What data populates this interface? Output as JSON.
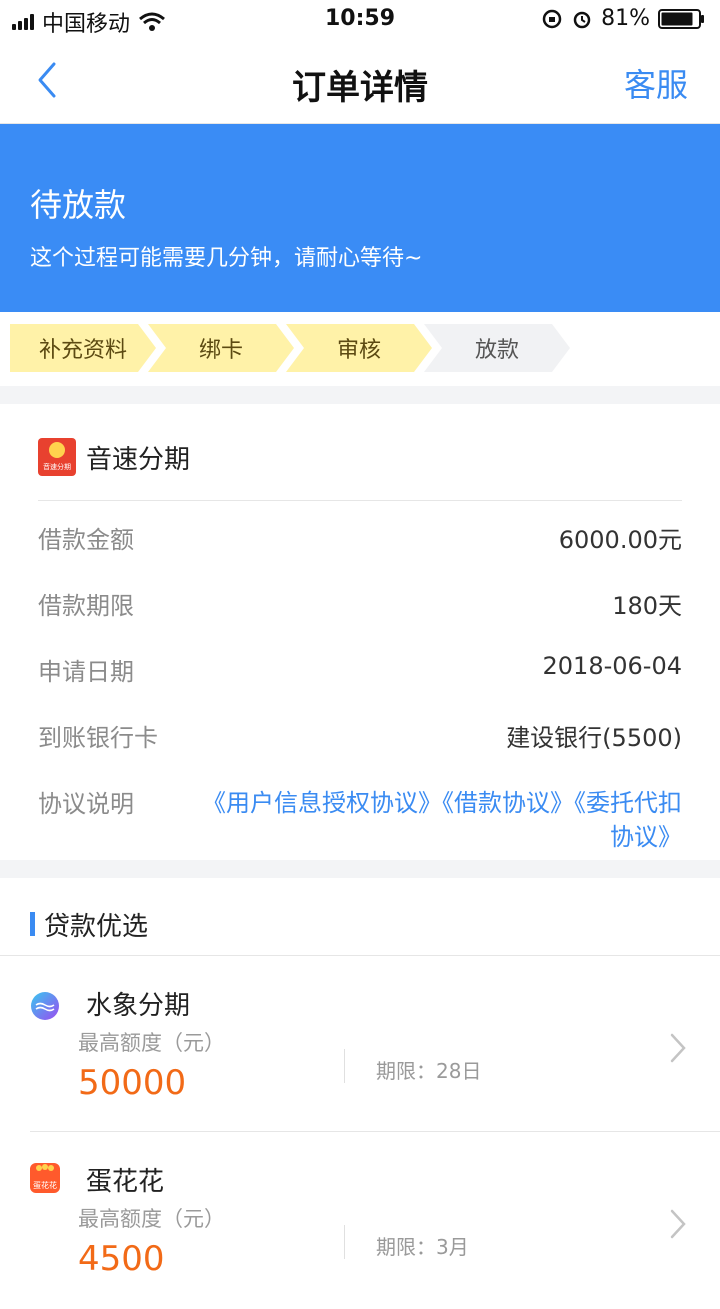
{
  "status_bar": {
    "carrier": "中国移动",
    "time": "10:59",
    "battery": "81%",
    "battery_level": 0.81
  },
  "nav": {
    "title": "订单详情",
    "service": "客服"
  },
  "banner": {
    "status": "待放款",
    "description": "这个过程可能需要几分钟，请耐心等待~"
  },
  "steps": [
    {
      "label": "补充资料",
      "state": "done"
    },
    {
      "label": "绑卡",
      "state": "done"
    },
    {
      "label": "审核",
      "state": "current"
    },
    {
      "label": "放款",
      "state": "pending"
    }
  ],
  "order": {
    "product_name": "音速分期",
    "logo_text": "音速分期",
    "rows": [
      {
        "label": "借款金额",
        "value": "6000.00元"
      },
      {
        "label": "借款期限",
        "value": "180天"
      },
      {
        "label": "申请日期",
        "value": "2018-06-04"
      },
      {
        "label": "到账银行卡",
        "value": "建设银行(5500)"
      }
    ],
    "agreement_label": "协议说明",
    "agreements": "《用户信息授权协议》《借款协议》《委托代扣协议》"
  },
  "recommend": {
    "title": "贷款优选",
    "items": [
      {
        "name": "水象分期",
        "max_label": "最高额度（元）",
        "amount": "50000",
        "term": "期限：28日"
      },
      {
        "name": "蛋花花",
        "max_label": "最高额度（元）",
        "amount": "4500",
        "term": "期限：3月",
        "logo_text": "蛋花花"
      }
    ]
  },
  "colors": {
    "accent": "#3a8bf2",
    "banner": "#3a8cf5",
    "amount": "#f26a17",
    "step_active": "#fff2a8"
  }
}
